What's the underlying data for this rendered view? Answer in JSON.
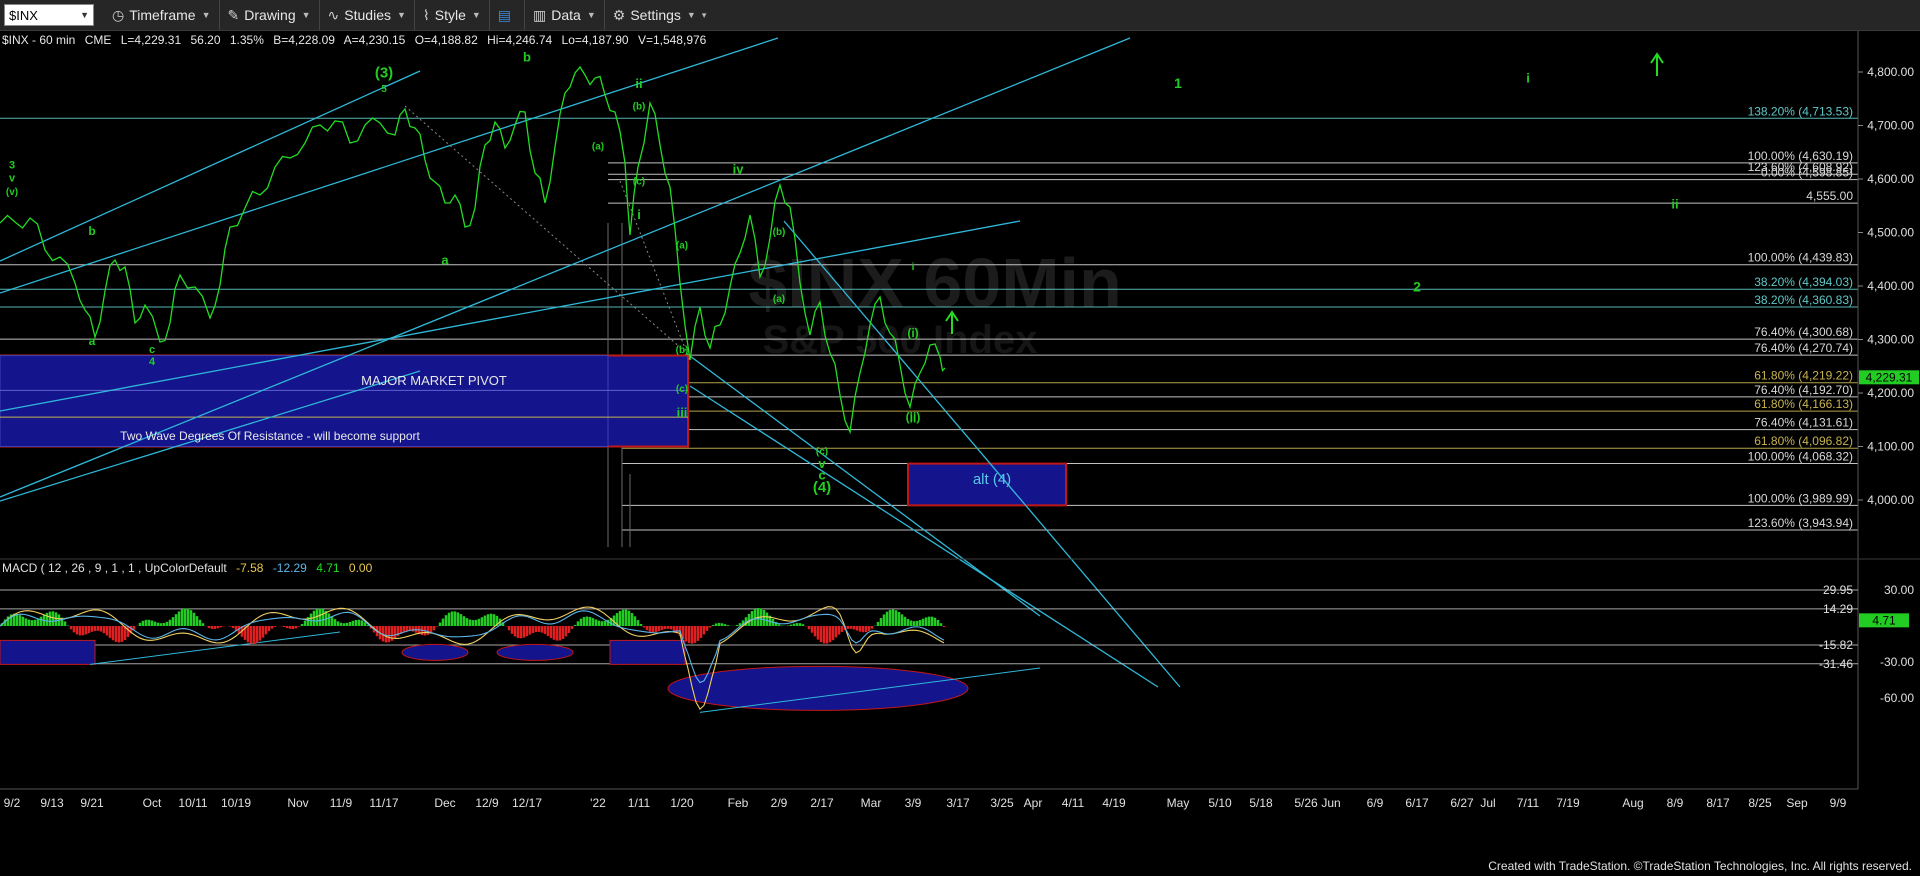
{
  "toolbar": {
    "symbol": "$INX",
    "timeframe_label": "Timeframe",
    "drawing_label": "Drawing",
    "studies_label": "Studies",
    "style_label": "Style",
    "data_label": "Data",
    "settings_label": "Settings"
  },
  "header": {
    "symbol": "$INX - 60 min",
    "exchange": "CME",
    "last": "L=4,229.31",
    "change": "56.20",
    "pct": "1.35%",
    "bid": "B=4,228.09",
    "ask": "A=4,230.15",
    "low_open": "O=4,188.82",
    "high": "Hi=4,246.74",
    "low": "Lo=4,187.90",
    "volume": "V=1,548,976"
  },
  "watermark": {
    "line1": "$INX 60Min",
    "line2": "S&P 500 Index"
  },
  "price_axis": {
    "ticks": [
      "4,800.00",
      "4,700.00",
      "4,600.00",
      "4,500.00",
      "4,400.00",
      "4,300.00",
      "4,200.00",
      "4,100.00",
      "4,000.00"
    ],
    "current": "4,229.31"
  },
  "macd": {
    "title": "MACD ( 12 , 26 , 9 , 1 , 1 , UpColorDefault",
    "v1": "-7.58",
    "v2": "-12.29",
    "v3": "4.71",
    "v4": "0.00",
    "axis_ticks": [
      "30.00",
      "-30.00",
      "-60.00"
    ],
    "levels": [
      "29.95",
      "14.29",
      "-15.82",
      "-31.46"
    ],
    "current": "4.71"
  },
  "time_axis": [
    "9/2",
    "9/13",
    "9/21",
    "Oct",
    "10/11",
    "10/19",
    "Nov",
    "11/9",
    "11/17",
    "Dec",
    "12/9",
    "12/17",
    "'22",
    "1/11",
    "1/20",
    "Feb",
    "2/9",
    "2/17",
    "Mar",
    "3/9",
    "3/17",
    "3/25",
    "Apr",
    "4/11",
    "4/19",
    "May",
    "5/10",
    "5/18",
    "5/26",
    "Jun",
    "6/9",
    "6/17",
    "6/27",
    "Jul",
    "7/11",
    "7/19",
    "Aug",
    "8/9",
    "8/17",
    "8/25",
    "Sep",
    "9/9"
  ],
  "fib_labels": [
    {
      "text": "138.20% (4,713.53)",
      "price": 4713.53,
      "color": "#5fc8c8"
    },
    {
      "text": "100.00% (4,630.19)",
      "price": 4630.19,
      "color": "#d8d8d8"
    },
    {
      "text": "123.60% (4,608.92)",
      "price": 4608.92,
      "color": "#d8d8d8"
    },
    {
      "text": "0.00% (4,598.85)",
      "price": 4598.85,
      "color": "#d8d8d8"
    },
    {
      "text": "4,555.00",
      "price": 4555.0,
      "color": "#d8d8d8"
    },
    {
      "text": "100.00% (4,439.83)",
      "price": 4439.83,
      "color": "#d8d8d8"
    },
    {
      "text": "38.20% (4,394.03)",
      "price": 4394.03,
      "color": "#5fc8c8"
    },
    {
      "text": "38.20% (4,360.83)",
      "price": 4360.83,
      "color": "#5fc8c8"
    },
    {
      "text": "76.40% (4,300.68)",
      "price": 4300.68,
      "color": "#d8d8d8"
    },
    {
      "text": "76.40% (4,270.74)",
      "price": 4270.74,
      "color": "#d8d8d8"
    },
    {
      "text": "61.80% (4,219.22)",
      "price": 4219.22,
      "color": "#c8b450"
    },
    {
      "text": "76.40% (4,192.70)",
      "price": 4192.7,
      "color": "#d8d8d8"
    },
    {
      "text": "61.80% (4,166.13)",
      "price": 4166.13,
      "color": "#c8b450"
    },
    {
      "text": "76.40% (4,131.61)",
      "price": 4131.61,
      "color": "#d8d8d8"
    },
    {
      "text": "61.80% (4,096.82)",
      "price": 4096.82,
      "color": "#c8b450"
    },
    {
      "text": "100.00% (4,068.32)",
      "price": 4068.32,
      "color": "#d8d8d8"
    },
    {
      "text": "100.00% (3,989.99)",
      "price": 3989.99,
      "color": "#d8d8d8"
    },
    {
      "text": "123.60% (3,943.94)",
      "price": 3943.94,
      "color": "#d8d8d8"
    }
  ],
  "annotations": {
    "pivot_title": "MAJOR MARKET PIVOT",
    "pivot_note": "Two Wave Degrees Of Resistance - will become support",
    "alt4": "alt (4)"
  },
  "wave_labels": [
    {
      "text": "(3)",
      "x": "11/17",
      "price": 4790,
      "size": 15,
      "color": "#22cc22"
    },
    {
      "text": "5",
      "x": "11/17",
      "price": 4763,
      "size": 10,
      "color": "#22cc22"
    },
    {
      "text": "b",
      "x": "12/17",
      "price": 4820,
      "size": 13,
      "color": "#22cc22"
    },
    {
      "text": "ii",
      "x": "1/11",
      "price": 4770,
      "size": 13,
      "color": "#22cc22"
    },
    {
      "text": "a",
      "x": "Dec",
      "price": 4440,
      "size": 13,
      "color": "#22cc22"
    },
    {
      "text": "iv",
      "x": "Feb",
      "price": 4610,
      "size": 13,
      "color": "#22cc22"
    },
    {
      "text": "i",
      "x": "1/11",
      "price": 4525,
      "size": 13,
      "color": "#22cc22"
    },
    {
      "text": "iii",
      "x": "1/20",
      "price": 4155,
      "size": 13,
      "color": "#22cc22"
    },
    {
      "text": "v",
      "x": "2/17",
      "price": 4060,
      "size": 13,
      "color": "#22cc22"
    },
    {
      "text": "c",
      "x": "2/17",
      "price": 4038,
      "size": 13,
      "color": "#22cc22"
    },
    {
      "text": "(4)",
      "x": "2/17",
      "price": 4015,
      "size": 15,
      "color": "#22cc22"
    },
    {
      "text": "(i)",
      "x": "3/9",
      "price": 4305,
      "size": 12,
      "color": "#22cc22"
    },
    {
      "text": "ii",
      "x": "3/9",
      "price": 4145,
      "size": 12,
      "color": "#22cc22"
    },
    {
      "text": "(ii)",
      "x": "3/9",
      "price": 4148,
      "size": 12,
      "color": "#22cc22"
    },
    {
      "text": "i",
      "x": "3/9",
      "price": 4430,
      "size": 10,
      "color": "#22cc22"
    },
    {
      "text": "(b)",
      "x": "2/9",
      "price": 4495,
      "size": 10,
      "color": "#22cc22"
    },
    {
      "text": "(a)",
      "x": "2/9",
      "price": 4370,
      "size": 10,
      "color": "#22cc22"
    },
    {
      "text": "(c)",
      "x": "2/17",
      "price": 4085,
      "size": 10,
      "color": "#22cc22"
    },
    {
      "text": "(c)",
      "x": "1/20",
      "price": 4202,
      "size": 10,
      "color": "#22cc22"
    },
    {
      "text": "(b)",
      "x": "1/20",
      "price": 4275,
      "size": 10,
      "color": "#22cc22"
    },
    {
      "text": "(a)",
      "x": "1/20",
      "price": 4470,
      "size": 10,
      "color": "#22cc22"
    },
    {
      "text": "(b)",
      "x": "1/11",
      "price": 4730,
      "size": 10,
      "color": "#22cc22"
    },
    {
      "text": "(a)",
      "x": "'22",
      "price": 4655,
      "size": 10,
      "color": "#22cc22"
    },
    {
      "text": "(c)",
      "x": "1/11",
      "price": 4590,
      "size": 10,
      "color": "#22cc22"
    },
    {
      "text": "3",
      "x": "9/2",
      "price": 4620,
      "size": 11,
      "color": "#22cc22"
    },
    {
      "text": "v",
      "x": "9/2",
      "price": 4595,
      "size": 11,
      "color": "#22cc22"
    },
    {
      "text": "(v)",
      "x": "9/2",
      "price": 4570,
      "size": 10,
      "color": "#22cc22"
    },
    {
      "text": "b",
      "x": "9/21",
      "price": 4495,
      "size": 12,
      "color": "#22cc22"
    },
    {
      "text": "a",
      "x": "9/21",
      "price": 4290,
      "size": 12,
      "color": "#22cc22"
    },
    {
      "text": "c",
      "x": "Oct",
      "price": 4275,
      "size": 11,
      "color": "#22cc22"
    },
    {
      "text": "4",
      "x": "Oct",
      "price": 4252,
      "size": 11,
      "color": "#22cc22"
    },
    {
      "text": "1",
      "x": "May",
      "price": 4770,
      "size": 14,
      "color": "#22cc22"
    },
    {
      "text": "i",
      "x": "7/11",
      "price": 4780,
      "size": 13,
      "color": "#22cc22"
    },
    {
      "text": "2",
      "x": "6/17",
      "price": 4390,
      "size": 14,
      "color": "#22cc22"
    },
    {
      "text": "ii",
      "x": "8/9",
      "price": 4545,
      "size": 13,
      "color": "#22cc22"
    }
  ],
  "colors": {
    "price": "#22dd22",
    "fib_white": "#d8d8d8",
    "fib_teal": "#5fc8c8",
    "fib_gold": "#c8b450",
    "channel": "#2fb8d8",
    "pivot_box": "#14148c",
    "pivot_border": "#c01818",
    "accent": "#22cc22"
  },
  "chart_data": {
    "type": "line",
    "title": "$INX - 60 min",
    "series": [
      {
        "name": "$INX",
        "x": [
          "9/2",
          "9/13",
          "9/21",
          "Oct",
          "10/11",
          "10/19",
          "Nov",
          "11/9",
          "11/17",
          "Dec",
          "12/9",
          "12/17",
          "'22",
          "1/11",
          "1/20",
          "Feb",
          "2/9",
          "2/17",
          "Mar",
          "3/9"
        ],
        "values": [
          4530,
          4460,
          4360,
          4300,
          4380,
          4470,
          4610,
          4690,
          4710,
          4560,
          4660,
          4700,
          4790,
          4690,
          4320,
          4560,
          4550,
          4210,
          4350,
          4229
        ]
      }
    ],
    "macd": {
      "macd": -7.58,
      "signal": -12.29,
      "histogram": 4.71
    }
  },
  "footer": "Created with TradeStation. ©TradeStation Technologies, Inc. All rights reserved."
}
